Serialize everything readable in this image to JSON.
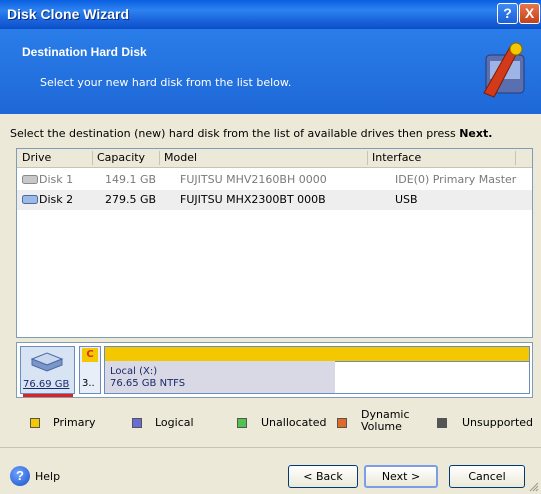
{
  "window": {
    "title": "Disk Clone Wizard",
    "help_button": "?",
    "close_button": "X"
  },
  "header": {
    "title": "Destination Hard Disk",
    "subtitle": "Select your new hard disk from the list below."
  },
  "instruction": {
    "text": "Select the destination (new) hard disk from the list of available drives then press ",
    "bold": "Next."
  },
  "table": {
    "columns": [
      "Drive",
      "Capacity",
      "Model",
      "Interface"
    ],
    "rows": [
      {
        "drive": "Disk 1",
        "capacity": "149.1 GB",
        "model": "FUJITSU MHV2160BH 0000",
        "interface": "IDE(0) Primary Master",
        "state": "disabled"
      },
      {
        "drive": "Disk 2",
        "capacity": "279.5 GB",
        "model": "FUJITSU MHX2300BT 000B",
        "interface": "USB",
        "state": "selected"
      }
    ]
  },
  "disk_map": {
    "disk_size": "76.69 GB",
    "partition_c": {
      "letter": "C",
      "label": "3.."
    },
    "partition_x": {
      "name": "Local (X:)",
      "details": "76.65 GB  NTFS"
    }
  },
  "legend": [
    {
      "label": "Primary",
      "color": "#f3c800"
    },
    {
      "label": "Logical",
      "color": "#6b6bd6"
    },
    {
      "label": "Unallocated",
      "color": "#4fc24f"
    },
    {
      "label": "Dynamic\nVolume",
      "color": "#e06a2a"
    },
    {
      "label": "Unsupported",
      "color": "#555555"
    }
  ],
  "footer": {
    "help": "Help",
    "back": "< Back",
    "next": "Next >",
    "cancel": "Cancel"
  }
}
